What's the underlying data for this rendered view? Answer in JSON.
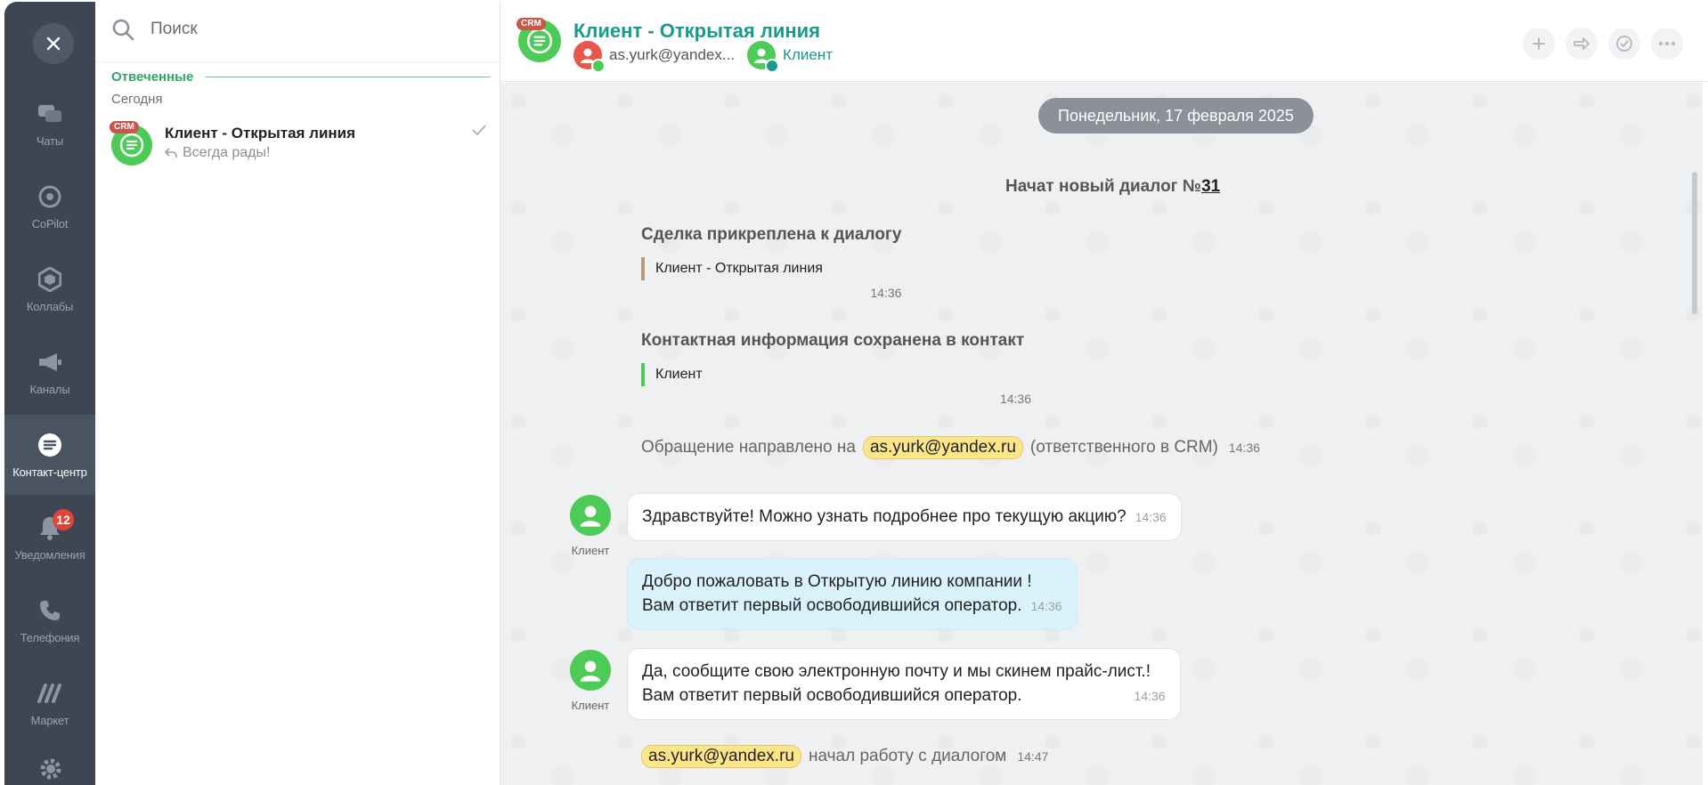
{
  "rail": {
    "items": [
      {
        "label": "Чаты",
        "icon": "chats-icon"
      },
      {
        "label": "CoPilot",
        "icon": "copilot-icon"
      },
      {
        "label": "Коллабы",
        "icon": "collabs-icon"
      },
      {
        "label": "Каналы",
        "icon": "megaphone-icon"
      },
      {
        "label": "Контакт-центр",
        "icon": "contact-center-icon",
        "active": true
      },
      {
        "label": "Уведомления",
        "icon": "bell-icon",
        "badge": "12"
      },
      {
        "label": "Телефония",
        "icon": "phone-icon"
      },
      {
        "label": "Маркет",
        "icon": "market-icon"
      }
    ]
  },
  "list": {
    "search_placeholder": "Поиск",
    "section": "Отвеченные",
    "subsection": "Сегодня",
    "chat": {
      "crm_tag": "CRM",
      "title": "Клиент - Открытая линия",
      "preview": "Всегда рады!"
    }
  },
  "header": {
    "crm_tag": "CRM",
    "title": "Клиент - Открытая линия",
    "member_operator": "as.yurk@yandex...",
    "member_client": "Клиент"
  },
  "chat": {
    "date": "Понедельник, 17 февраля 2025",
    "new_dialog_prefix": "Начат новый диалог №",
    "new_dialog_number": "31",
    "deal": {
      "title": "Сделка прикреплена к диалогу",
      "quote": "Клиент - Открытая линия",
      "time": "14:36",
      "bar_color": "#b89a7a"
    },
    "contact": {
      "title": "Контактная информация сохранена в контакт",
      "quote": "Клиент",
      "time": "14:36",
      "bar_color": "#4ccb57"
    },
    "assign": {
      "prefix": "Обращение направлено на",
      "mention": "as.yurk@yandex.ru",
      "suffix": "(ответственного в CRM)",
      "time": "14:36"
    },
    "messages": [
      {
        "author": "Клиент",
        "line1": "Здравствуйте! Можно узнать подробнее про текущую акцию?",
        "time": "14:36"
      },
      {
        "line1": "Добро пожаловать в Открытую линию компании !",
        "line2": "Вам ответит первый освободившийся оператор.",
        "time": "14:36"
      },
      {
        "author": "Клиент",
        "line1": "Да, сообщите свою электронную почту и мы скинем прайс-лист.!",
        "line2": "Вам ответит первый освободившийся оператор.",
        "time": "14:36"
      }
    ],
    "started": {
      "mention": "as.yurk@yandex.ru",
      "text": "начал работу с диалогом",
      "time": "14:47"
    }
  }
}
